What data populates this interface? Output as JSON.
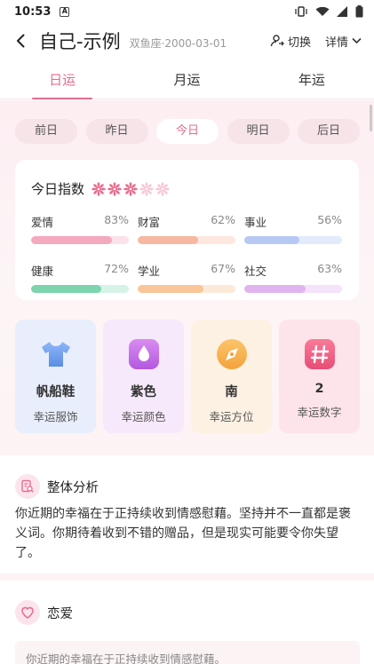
{
  "status": {
    "time": "10:53",
    "badge": "A"
  },
  "header": {
    "title": "自己-示例",
    "subtitle": "双鱼座·2000-03-01",
    "switch_label": "切换",
    "detail_label": "详情"
  },
  "tabs": [
    {
      "label": "日运",
      "active": true
    },
    {
      "label": "月运",
      "active": false
    },
    {
      "label": "年运",
      "active": false
    }
  ],
  "days": [
    {
      "label": "前日"
    },
    {
      "label": "昨日"
    },
    {
      "label": "今日"
    },
    {
      "label": "明日"
    },
    {
      "label": "后日"
    }
  ],
  "index": {
    "label": "今日指数",
    "stars_total": 5,
    "stars_filled": 3,
    "stats": [
      {
        "name": "爱情",
        "pct": "83%",
        "value": 83,
        "color": "#f4a9bf",
        "track": "#fbe2ea"
      },
      {
        "name": "财富",
        "pct": "62%",
        "value": 62,
        "color": "#f6b8a0",
        "track": "#fde7de"
      },
      {
        "name": "事业",
        "pct": "56%",
        "value": 56,
        "color": "#b7c9f2",
        "track": "#e3eafb"
      },
      {
        "name": "健康",
        "pct": "72%",
        "value": 72,
        "color": "#7fd4b0",
        "track": "#d6f3e7"
      },
      {
        "name": "学业",
        "pct": "67%",
        "value": 67,
        "color": "#f9c69a",
        "track": "#fde9d8"
      },
      {
        "name": "社交",
        "pct": "63%",
        "value": 63,
        "color": "#e0b5ef",
        "track": "#f4e3fa"
      }
    ]
  },
  "lucky": [
    {
      "value": "帆船鞋",
      "caption": "幸运服饰",
      "icon": "tshirt-icon",
      "bg": "#e8eefb"
    },
    {
      "value": "紫色",
      "caption": "幸运颜色",
      "icon": "droplet-icon",
      "bg": "#f6e9fb"
    },
    {
      "value": "南",
      "caption": "幸运方位",
      "icon": "compass-icon",
      "bg": "#fdf1e3"
    },
    {
      "value": "2",
      "caption": "幸运数字",
      "icon": "hash-icon",
      "bg": "#fde4ea"
    }
  ],
  "overall": {
    "title": "整体分析",
    "text": "你近期的幸福在于正持续收到情感慰藉。坚持并不一直都是褒义词。你期待着收到不错的赠品，但是现实可能要令你失望了。"
  },
  "love": {
    "title": "恋爱",
    "text": "你近期的幸福在于正持续收到情感慰藉。"
  }
}
